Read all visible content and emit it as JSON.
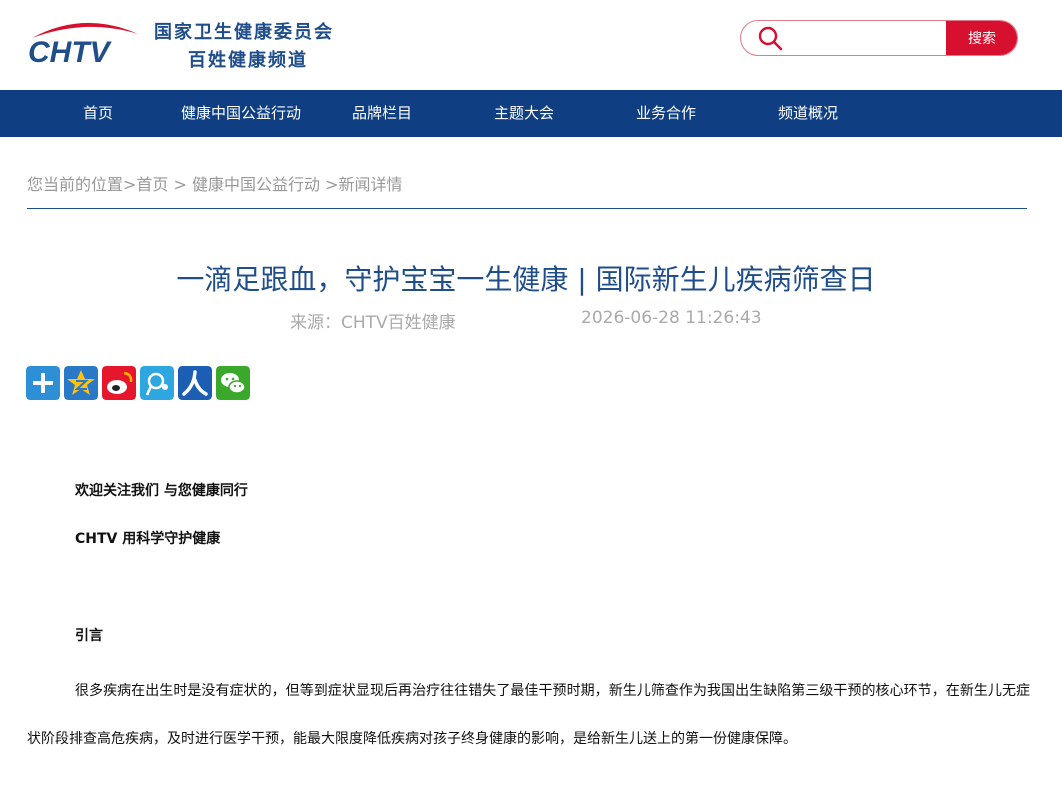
{
  "header": {
    "logo_mark_text": "CHTV",
    "logo_line1": "国家卫生健康委员会",
    "logo_line2": "百姓健康频道",
    "search": {
      "value": "",
      "placeholder": "",
      "button_label": "搜索"
    }
  },
  "nav": {
    "items": [
      "首页",
      "健康中国公益行动",
      "品牌栏目",
      "主题大会",
      "业务合作",
      "频道概况"
    ]
  },
  "breadcrumb": {
    "prefix": "您当前的位置",
    "sep1": ">",
    "home": "首页",
    "sep2": " > ",
    "section": "健康中国公益行动",
    "sep3": " >",
    "current": "新闻详情"
  },
  "article": {
    "title": "一滴足跟血，守护宝宝一生健康 | 国际新生儿疾病筛查日",
    "source": "来源：CHTV百姓健康",
    "datetime": "2026-06-28 11:26:43",
    "share_icons": [
      "plus-share-icon",
      "qzone-icon",
      "weibo-icon",
      "tencent-weibo-icon",
      "renren-icon",
      "wechat-icon"
    ],
    "welcome": "欢迎关注我们 与您健康同行",
    "slogan": "CHTV 用科学守护健康",
    "intro_heading": "引言",
    "body": "很多疾病在出生时是没有症状的，但等到症状显现后再治疗往往错失了最佳干预时期，新生儿筛查作为我国出生缺陷第三级干预的核心环节，在新生儿无症状阶段排查高危疾病，及时进行医学干预，能最大限度降低疾病对孩子终身健康的影响，是给新生儿送上的第一份健康保障。"
  },
  "colors": {
    "brand_blue": "#0f3f82",
    "title_blue": "#1f4e8a",
    "search_red": "#d8102f",
    "logo_red": "#d8102f",
    "wechat_green": "#3aa82b"
  }
}
